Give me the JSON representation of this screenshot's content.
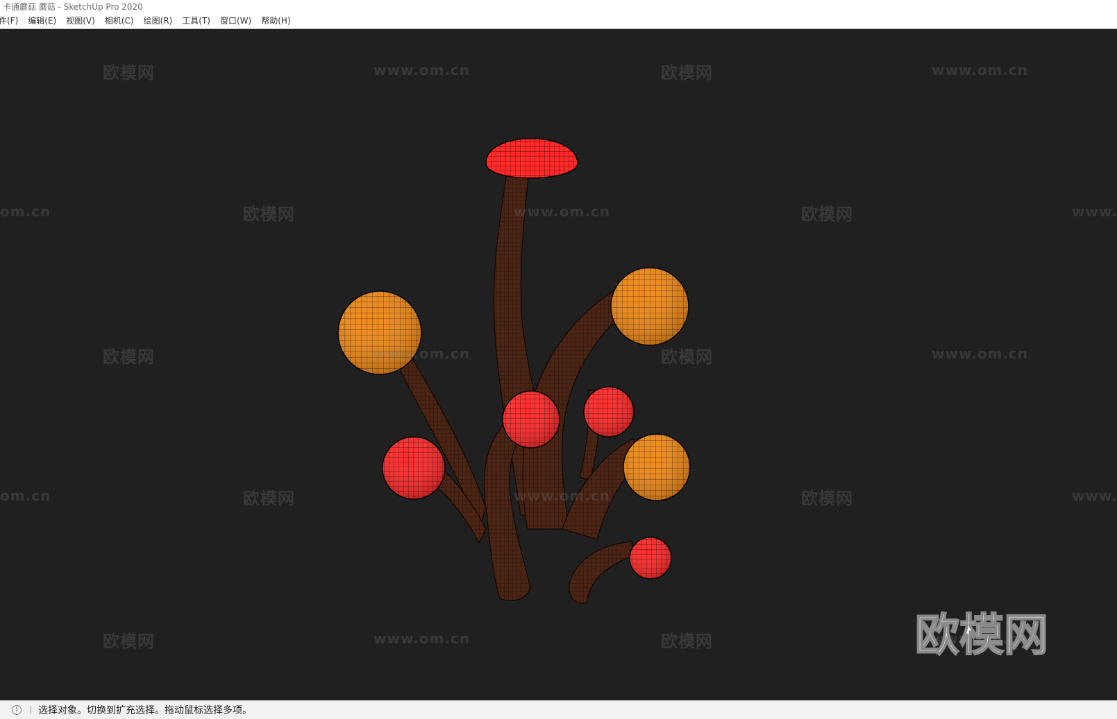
{
  "window": {
    "title": "卡通蘑菇 蘑菇 - SketchUp Pro 2020"
  },
  "menu": {
    "items": [
      {
        "label": "件(F)"
      },
      {
        "label": "编辑(E)"
      },
      {
        "label": "视图(V)"
      },
      {
        "label": "相机(C)"
      },
      {
        "label": "绘图(R)"
      },
      {
        "label": "工具(T)"
      },
      {
        "label": "窗口(W)"
      },
      {
        "label": "帮助(H)"
      }
    ]
  },
  "viewport": {
    "background": "#202020",
    "watermarks": {
      "brand": "欧模网",
      "url": "www.om.cn",
      "url_partial_left": "om.cn",
      "url_partial_right": "www."
    },
    "big_watermark": "欧模网",
    "model": {
      "name": "卡通蘑菇",
      "stem_color": "#4a2414",
      "cap_colors": {
        "red": "#ff2a2a",
        "orange": "#f08a18"
      }
    }
  },
  "statusbar": {
    "icon": "info-icon",
    "message": "选择对象。切换到扩充选择。拖动鼠标选择多项。"
  }
}
